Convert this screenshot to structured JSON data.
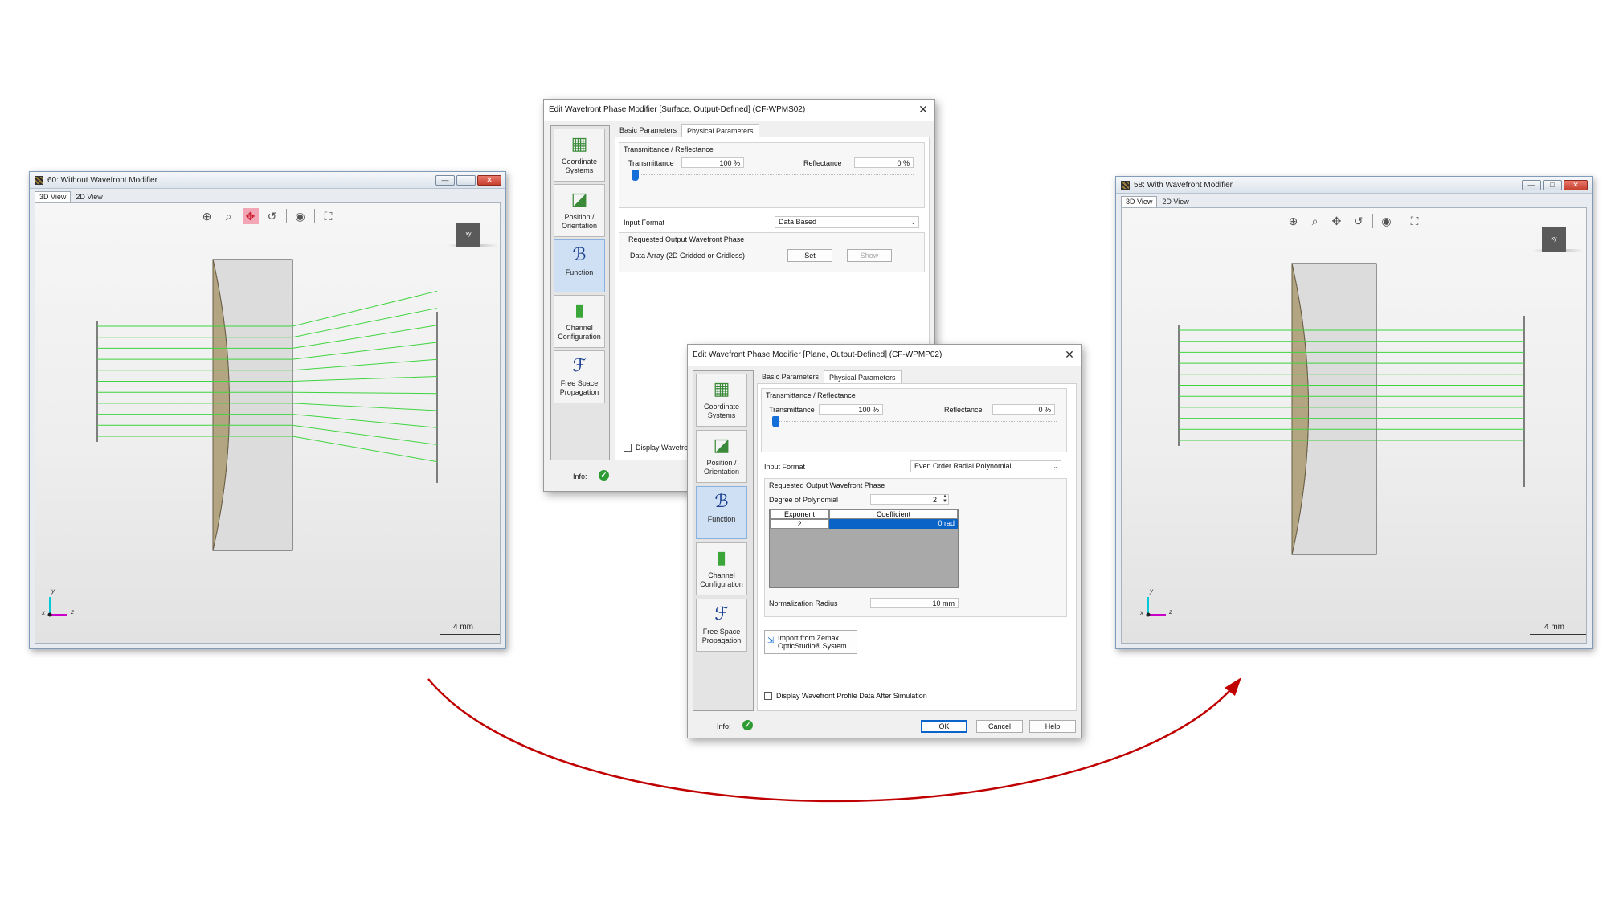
{
  "left_view": {
    "title": "60: Without Wavefront Modifier",
    "tabs": [
      "3D View",
      "2D View"
    ],
    "cube_label": "xy",
    "scale": "4 mm",
    "axes": {
      "y": "y",
      "x": "x",
      "z": "z"
    }
  },
  "right_view": {
    "title": "58: With Wavefront Modifier",
    "tabs": [
      "3D View",
      "2D View"
    ],
    "cube_label": "xy",
    "scale": "4 mm",
    "axes": {
      "y": "y",
      "x": "x",
      "z": "z"
    }
  },
  "window_buttons": {
    "minimize": "—",
    "maximize": "□",
    "close": "✕"
  },
  "toolbar_icons": [
    "zoom-region-icon",
    "zoom-icon",
    "pan-icon",
    "rotate-icon",
    "view-icon",
    "fit-icon"
  ],
  "dialog1": {
    "title": "Edit Wavefront Phase Modifier [Surface, Output-Defined] (CF-WPMS02)",
    "tabs": [
      "Basic Parameters",
      "Physical Parameters"
    ],
    "sidebar": [
      "Coordinate Systems",
      "Position / Orientation",
      "Function",
      "Channel Configuration",
      "Free Space Propagation"
    ],
    "trans_group": "Transmittance / Reflectance",
    "transmittance_label": "Transmittance",
    "transmittance_value": "100 %",
    "reflectance_label": "Reflectance",
    "reflectance_value": "0 %",
    "input_format_label": "Input Format",
    "input_format_value": "Data Based",
    "requested_group": "Requested Output Wavefront Phase",
    "data_array_label": "Data Array (2D Gridded or Gridless)",
    "set_label": "Set",
    "show_label": "Show",
    "display_label": "Display Wavefront",
    "info_label": "Info:"
  },
  "dialog2": {
    "title": "Edit Wavefront Phase Modifier [Plane, Output-Defined] (CF-WPMP02)",
    "tabs": [
      "Basic Parameters",
      "Physical Parameters"
    ],
    "sidebar": [
      "Coordinate Systems",
      "Position / Orientation",
      "Function",
      "Channel Configuration",
      "Free Space Propagation"
    ],
    "trans_group": "Transmittance / Reflectance",
    "transmittance_label": "Transmittance",
    "transmittance_value": "100 %",
    "reflectance_label": "Reflectance",
    "reflectance_value": "0 %",
    "input_format_label": "Input Format",
    "input_format_value": "Even Order Radial Polynomial",
    "requested_group": "Requested Output Wavefront Phase",
    "degree_label": "Degree of Polynomial",
    "degree_value": "2",
    "table_headers": [
      "Exponent",
      "Coefficient"
    ],
    "table_rows": [
      {
        "exponent": "2",
        "coefficient": "0 rad"
      }
    ],
    "norm_label": "Normalization Radius",
    "norm_value": "10 mm",
    "import_label": "Import from Zemax OpticStudio® System",
    "display_label": "Display Wavefront Profile Data After Simulation",
    "info_label": "Info:",
    "ok": "OK",
    "cancel": "Cancel",
    "help": "Help"
  },
  "colors": {
    "rays": "#3ed43e",
    "lens": "#b3a581",
    "arrow": "#c00000",
    "accent": "#1470d8"
  }
}
